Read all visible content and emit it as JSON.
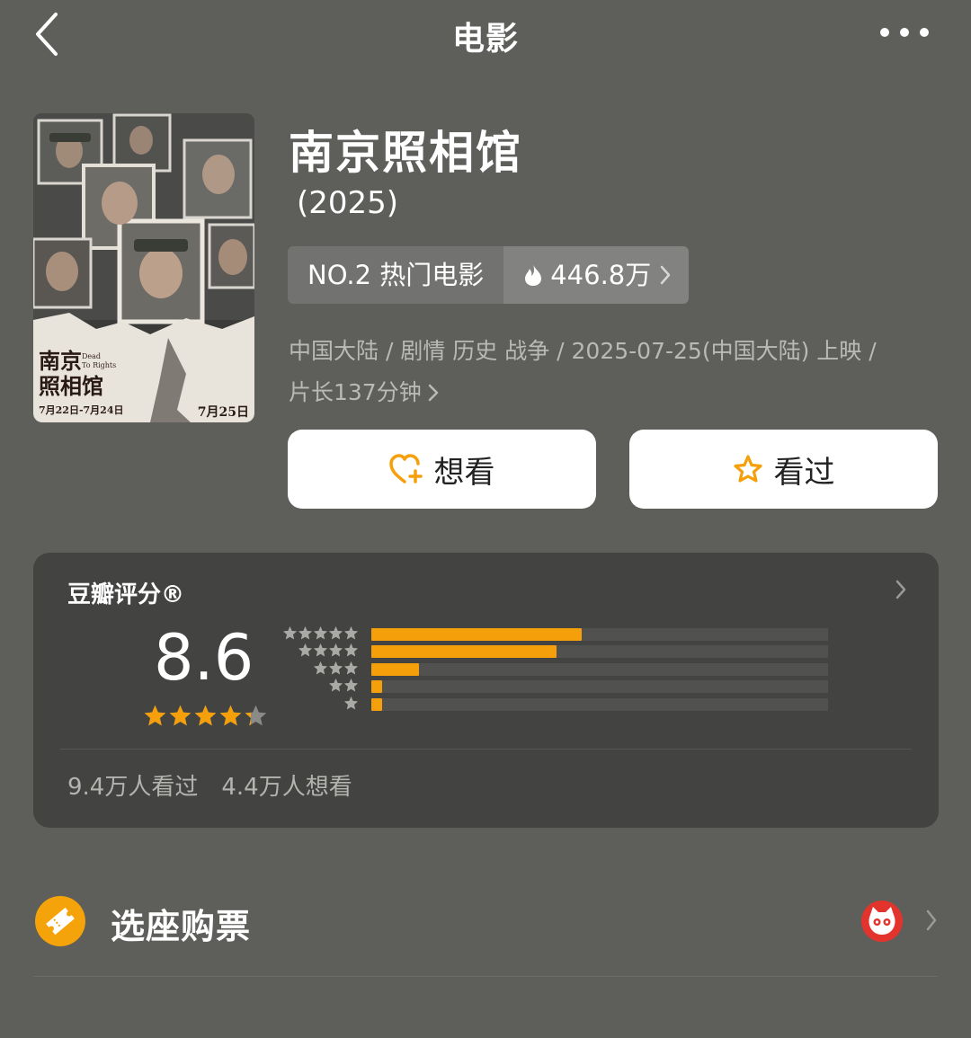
{
  "nav": {
    "title": "电影",
    "back_icon": "chevron-left-icon",
    "more_icon": "more-dots-icon"
  },
  "poster": {
    "title_line1": "南京",
    "title_line2": "照相馆",
    "english_title_line1": "Dead",
    "english_title_line2": "To Rights",
    "preview_dates": "7月22日-7月24日",
    "release_date": "7月25日"
  },
  "movie": {
    "title": "南京照相馆",
    "year": "(2025)",
    "rank_label": "NO.2 热门电影",
    "heat_value": "446.8万",
    "meta_line1": "中国大陆 / 剧情 历史 战争 / 2025-07-25(中国大陆) 上映 /",
    "meta_duration": "片长137分钟"
  },
  "actions": {
    "want_label": "想看",
    "seen_label": "看过"
  },
  "rating": {
    "heading": "豆瓣评分®",
    "score": "8.6",
    "star_level_of_5": 4.3,
    "distribution_percent": [
      46.0,
      40.5,
      10.5,
      2.0,
      1.0
    ],
    "seen_count": "9.4万人看过",
    "want_count": "4.4万人想看"
  },
  "tickets": {
    "label": "选座购票",
    "provider_icon": "maoyan-cat-logo-icon"
  },
  "colors": {
    "background": "#5e5e5b",
    "card": "#434341",
    "accent": "#f5a00b"
  }
}
